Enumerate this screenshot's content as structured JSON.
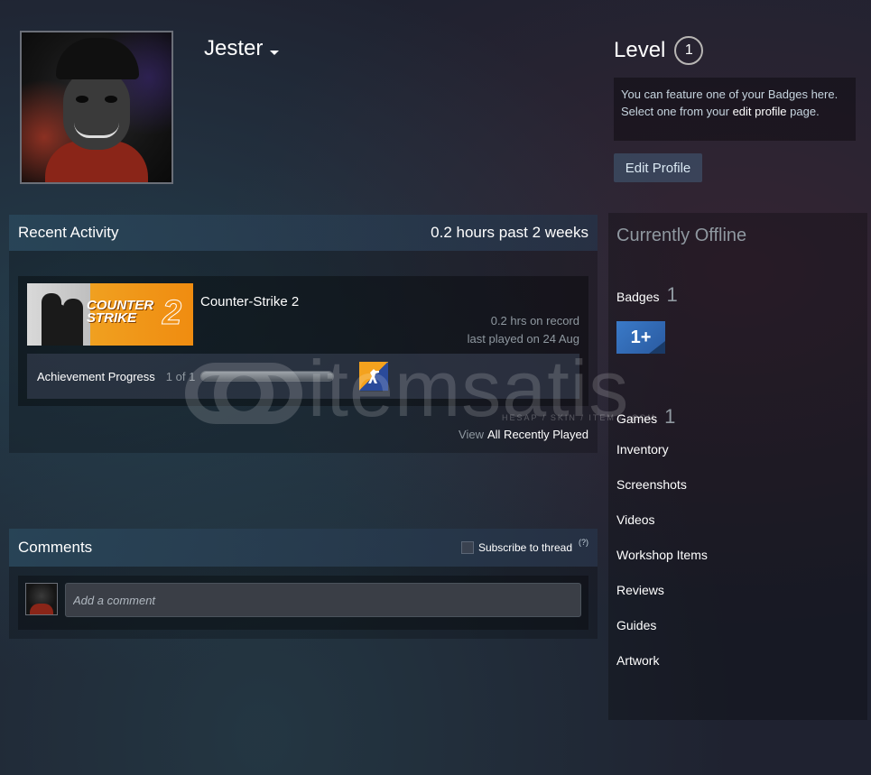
{
  "profile": {
    "persona_name": "Jester"
  },
  "level": {
    "label": "Level",
    "value": "1",
    "badge_note_line1": "You can feature one of your Badges here.",
    "badge_note_line2_prefix": "Select one from your ",
    "badge_note_link": "edit profile",
    "badge_note_line2_suffix": " page.",
    "edit_profile_label": "Edit Profile"
  },
  "recent_activity": {
    "title": "Recent Activity",
    "summary": "0.2 hours past 2 weeks",
    "game": {
      "name": "Counter-Strike 2",
      "capsule_text_1": "COUNTER",
      "capsule_text_2": "STRIKE",
      "capsule_text_3": "2",
      "hours_on_record": "0.2 hrs on record",
      "last_played": "last played on 24 Aug",
      "achievement_label": "Achievement Progress",
      "achievement_count": "1 of 1",
      "achievement_progress": 1.0
    },
    "view_label": "View",
    "view_all_link": "All Recently Played"
  },
  "comments": {
    "title": "Comments",
    "subscribe_label": "Subscribe to thread",
    "help_mark": "(?)",
    "input_placeholder": "Add a comment"
  },
  "sidebar": {
    "status": "Currently Offline",
    "badges_label": "Badges",
    "badges_count": "1",
    "badge_text": "1+",
    "games_label": "Games",
    "games_count": "1",
    "items": [
      {
        "label": "Inventory"
      },
      {
        "label": "Screenshots"
      },
      {
        "label": "Videos"
      },
      {
        "label": "Workshop Items"
      },
      {
        "label": "Reviews"
      },
      {
        "label": "Guides"
      },
      {
        "label": "Artwork"
      }
    ]
  },
  "watermark": {
    "text": "itemsatis",
    "sub": "HESAP / SKIN / ITEM / .COM"
  },
  "colors": {
    "background": "#1f2230",
    "accent_blue": "#67c1f5",
    "text_white": "#ffffff",
    "text_muted": "#8f98a0",
    "cs_orange": "#f08c10"
  }
}
